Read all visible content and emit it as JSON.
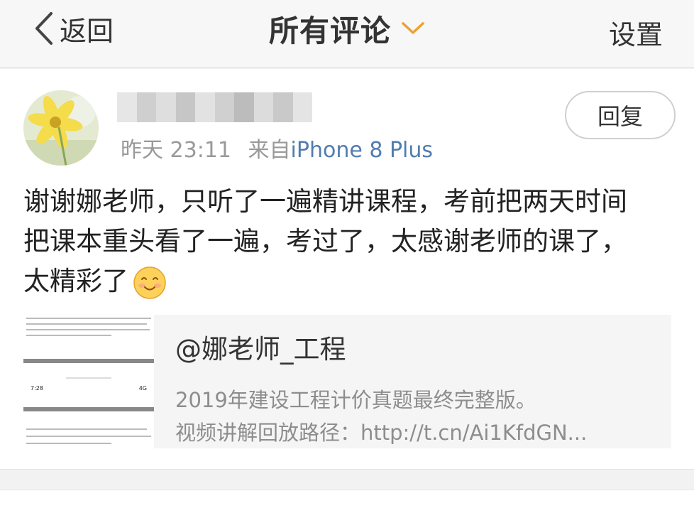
{
  "navbar": {
    "back_label": "返回",
    "title": "所有评论",
    "settings_label": "设置",
    "accent_color": "#f0a030"
  },
  "comment": {
    "time": "昨天 23:11",
    "from_prefix": "来自",
    "source": "iPhone 8 Plus",
    "reply_label": "回复",
    "text": "谢谢娜老师，只听了一遍精讲课程，考前把两天时间\n把课本重头看了一遍，考过了，太感谢老师的课了，\n太精彩了",
    "emoji": "smile-emoji"
  },
  "share": {
    "title": "@娜老师_工程",
    "line1": "2019年建设工程计价真题最终完整版。",
    "line2": "视频讲解回放路径：http://t.cn/Ai1KfdGN...",
    "thumb_time": "7:28",
    "thumb_status": "4G"
  },
  "colors": {
    "link_blue": "#507daf",
    "muted_gray": "#999999"
  }
}
